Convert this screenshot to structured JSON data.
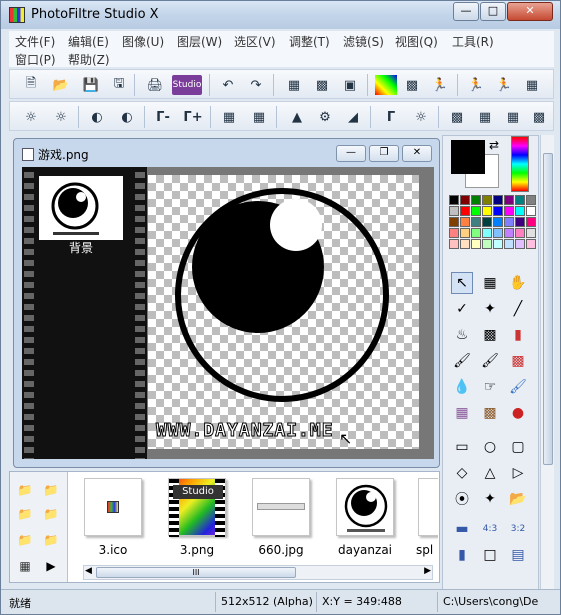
{
  "window": {
    "title": "PhotoFiltre Studio X"
  },
  "menu": {
    "row1": [
      "文件(F)",
      "编辑(E)",
      "图像(U)",
      "图层(W)",
      "选区(V)",
      "调整(T)",
      "滤镜(S)",
      "视图(Q)",
      "工具(R)"
    ],
    "row2": [
      "窗口(P)",
      "帮助(Z)"
    ]
  },
  "document": {
    "title": "游戏.png",
    "layer_label": "背景",
    "watermark": "WWW.DAYANZAI.ME"
  },
  "explorer": {
    "files": [
      {
        "name": "3.ico"
      },
      {
        "name": "3.png",
        "badge": "Studio"
      },
      {
        "name": "660.jpg"
      },
      {
        "name": "dayanzai"
      },
      {
        "name": "spl"
      }
    ],
    "scroll_grip": "III"
  },
  "status": {
    "state": "就绪",
    "size": "512x512 (Alpha)",
    "coords": "X:Y = 349:488",
    "path": "C:\\Users\\cong\\De"
  },
  "colors": {
    "foreground": "#000000",
    "background": "#ffffff",
    "palette": [
      "#000000",
      "#800000",
      "#008000",
      "#808000",
      "#000080",
      "#800080",
      "#008080",
      "#808080",
      "#c0c0c0",
      "#ff0000",
      "#00ff00",
      "#ffff00",
      "#0000ff",
      "#ff00ff",
      "#00ffff",
      "#ffffff",
      "#804000",
      "#ff8040",
      "#408080",
      "#004040",
      "#0080ff",
      "#8080ff",
      "#400080",
      "#ff0080",
      "#ff8080",
      "#ffd080",
      "#80ff80",
      "#80ffff",
      "#80c0ff",
      "#c080ff",
      "#ff80c0",
      "#e0e0e0",
      "#ffc0c0",
      "#ffe0c0",
      "#ffffc0",
      "#c0ffc0",
      "#c0ffff",
      "#c0e0ff",
      "#e0c0ff",
      "#ffc0e0"
    ]
  }
}
